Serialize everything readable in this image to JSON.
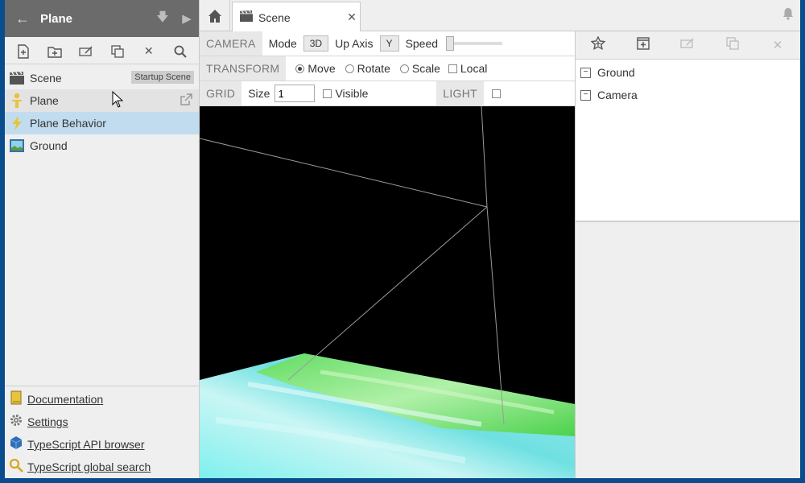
{
  "project": {
    "title": "Plane"
  },
  "tree": {
    "items": [
      {
        "label": "Scene",
        "badge": "Startup Scene"
      },
      {
        "label": "Plane"
      },
      {
        "label": "Plane Behavior"
      },
      {
        "label": "Ground"
      }
    ]
  },
  "links": [
    {
      "label": "Documentation"
    },
    {
      "label": "Settings"
    },
    {
      "label": "TypeScript API browser"
    },
    {
      "label": "TypeScript global search"
    }
  ],
  "tab": {
    "label": "Scene"
  },
  "camera": {
    "section": "CAMERA",
    "mode_label": "Mode",
    "mode_value": "3D",
    "upaxis_label": "Up Axis",
    "upaxis_value": "Y",
    "speed_label": "Speed"
  },
  "transform": {
    "section": "TRANSFORM",
    "options": [
      "Move",
      "Rotate",
      "Scale"
    ],
    "selected": "Move",
    "local_label": "Local"
  },
  "grid": {
    "section": "GRID",
    "size_label": "Size",
    "size_value": "1",
    "visible_label": "Visible",
    "light_section": "LIGHT"
  },
  "hierarchy": {
    "items": [
      {
        "label": "Ground"
      },
      {
        "label": "Camera"
      }
    ]
  },
  "colors": {
    "header_bg": "#6b6b6b",
    "selected_row": "#c2dcef",
    "viewport_bg": "#000000"
  }
}
